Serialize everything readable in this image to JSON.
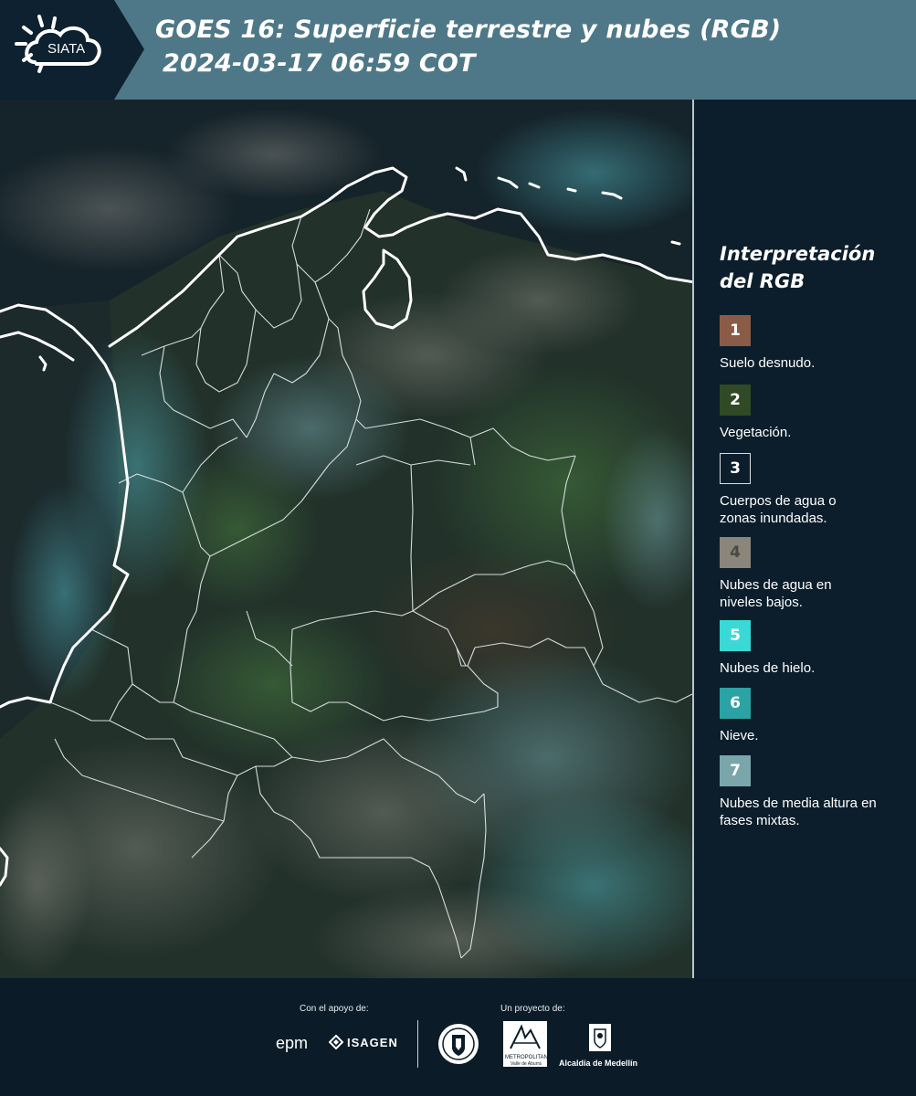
{
  "header": {
    "logo_text": "SIATA",
    "title_line1": "GOES 16: Superficie terrestre y nubes (RGB)",
    "title_line2": "2024-03-17 06:59 COT"
  },
  "legend": {
    "title_line1": "Interpretación",
    "title_line2": "del RGB",
    "items": [
      {
        "number": "1",
        "label": "Suelo desnudo.",
        "color": "#8a5c47",
        "border": "#8a5c47",
        "number_color": "#ffffff"
      },
      {
        "number": "2",
        "label": "Vegetación.",
        "color": "#2f4a25",
        "border": "#2f4a25",
        "number_color": "#ffffff"
      },
      {
        "number": "3",
        "label": "Cuerpos de agua o zonas inundadas.",
        "color": "#0c1e2b",
        "border": "#d8dde0",
        "number_color": "#ffffff"
      },
      {
        "number": "4",
        "label": "Nubes de agua en niveles bajos.",
        "color": "#8b857c",
        "border": "#8b857c",
        "number_color": "#4a4843"
      },
      {
        "number": "5",
        "label": "Nubes de hielo.",
        "color": "#3ad9d6",
        "border": "#3ad9d6",
        "number_color": "#ffffff"
      },
      {
        "number": "6",
        "label": "Nieve.",
        "color": "#2ba2a3",
        "border": "#2ba2a3",
        "number_color": "#ffffff"
      },
      {
        "number": "7",
        "label": "Nubes de media altura en fases mixtas.",
        "color": "#7aa6ab",
        "border": "#7aa6ab",
        "number_color": "#ffffff"
      }
    ]
  },
  "footer": {
    "support_label": "Con el apoyo de:",
    "project_label": "Un proyecto de:",
    "sponsor_1": "epm",
    "sponsor_2": "ISAGEN",
    "partner_1": "METROPOLITANA",
    "partner_1_sub": "Valle de Aburrá",
    "partner_2": "Alcaldía de Medellín"
  },
  "colors": {
    "header_bg": "#4e7888",
    "page_bg": "#0c1e2b",
    "border_line": "#ffffff"
  }
}
